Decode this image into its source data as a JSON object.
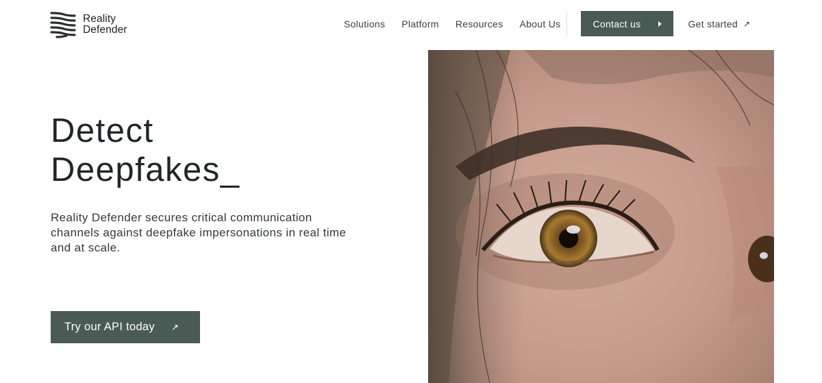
{
  "header": {
    "logo_line1": "Reality",
    "logo_line2": "Defender",
    "nav": [
      {
        "label": "Solutions"
      },
      {
        "label": "Platform"
      },
      {
        "label": "Resources"
      },
      {
        "label": "About Us"
      }
    ],
    "contact_label": "Contact us",
    "get_started_label": "Get started"
  },
  "hero": {
    "title_line1": "Detect",
    "title_line2": "Deepfakes_",
    "description": "Reality Defender secures critical communication channels against deepfake impersonations in real time and at scale.",
    "cta_label": "Try our API today"
  },
  "colors": {
    "accent": "#4a5a54",
    "text": "#1f2326"
  },
  "icons": {
    "logo": "stacked-wave-lines-icon",
    "contact_caret": "caret-right-icon",
    "external": "arrow-up-right-icon"
  }
}
